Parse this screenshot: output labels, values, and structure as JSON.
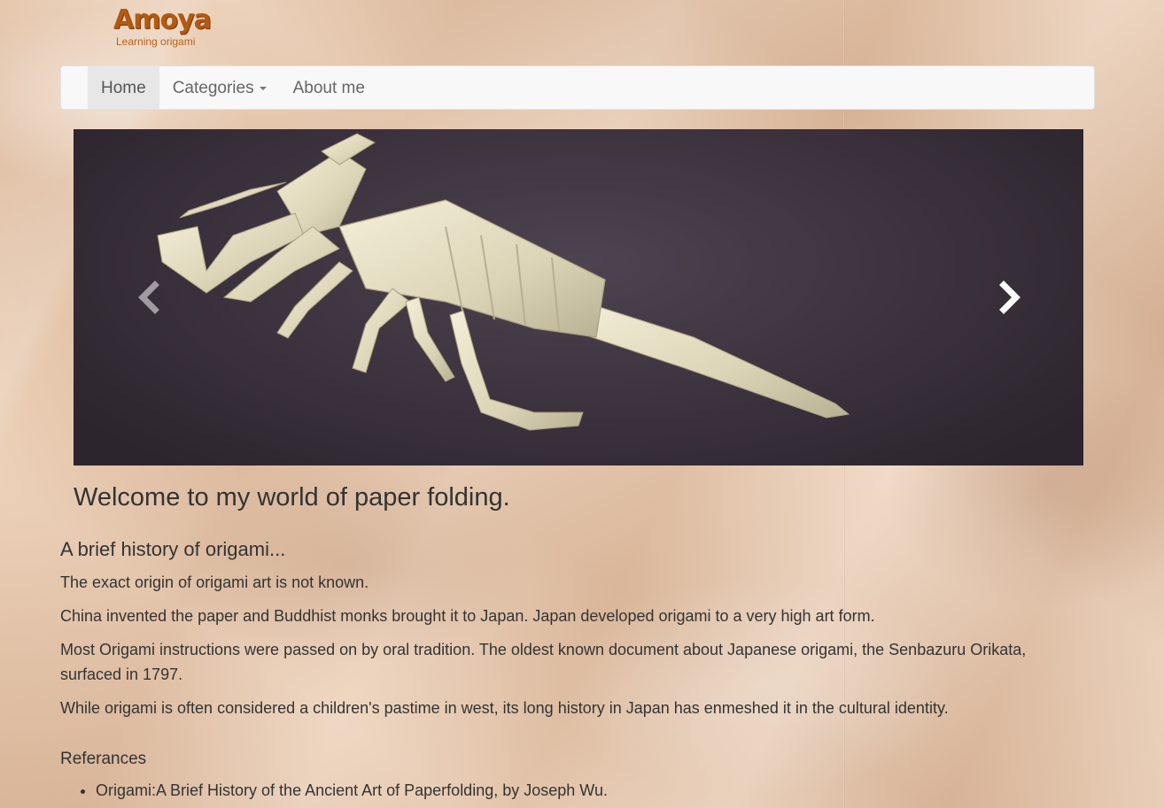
{
  "brand": {
    "logo_text": "Amoya",
    "tagline": "Learning origami",
    "color": "#b25a12"
  },
  "nav": {
    "items": [
      {
        "label": "Home",
        "active": true
      },
      {
        "label": "Categories",
        "dropdown": true
      },
      {
        "label": "About me"
      }
    ]
  },
  "carousel": {
    "image_subject": "origami-scorpion",
    "prev_icon": "chevron-left-icon",
    "next_icon": "chevron-right-icon"
  },
  "main": {
    "welcome": "Welcome to my world of paper folding.",
    "history_title": "A brief history of origami...",
    "paragraphs": [
      "The exact origin of origami art is not known.",
      "China invented the paper and Buddhist monks brought it to Japan. Japan developed origami to a very high art form.",
      "Most Origami instructions were passed on by oral tradition. The oldest known document about Japanese origami, the Senbazuru Orikata, surfaced in 1797.",
      "While origami is often considered a children's pastime in west, its long history in Japan has enmeshed it in the cultural identity."
    ],
    "references_title": "Referances",
    "references": [
      "Origami:A Brief History of the Ancient Art of Paperfolding, by Joseph Wu."
    ]
  },
  "colors": {
    "background": "#e9c9ad",
    "navbar": "#f8f8f8",
    "text": "#333333"
  }
}
